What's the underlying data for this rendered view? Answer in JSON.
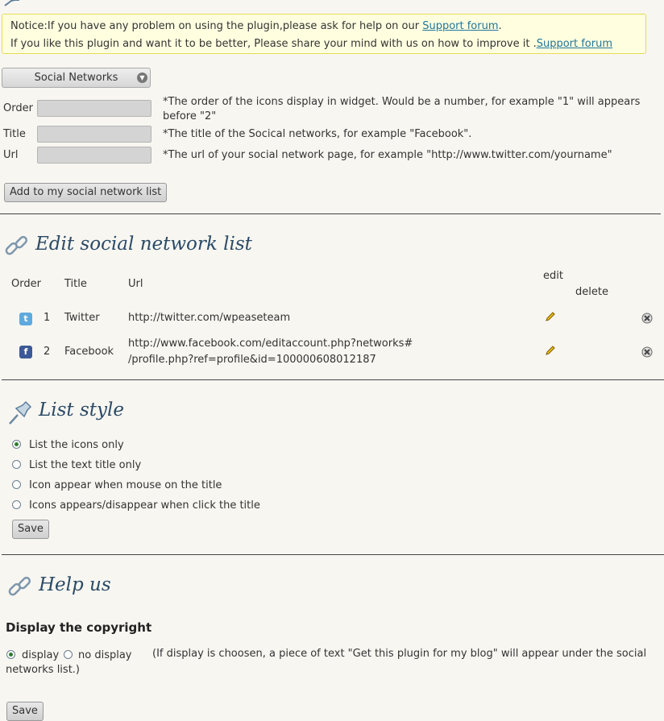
{
  "notice": {
    "line1_prefix": "Notice:If you have any problem on using the plugin,please ask for help on our ",
    "line1_link": "Support forum",
    "line1_suffix": ".",
    "line2_prefix": "If you like this plugin and want it to be better, Please share your mind with us on how to improve it .",
    "line2_link": "Support forum"
  },
  "add_form": {
    "network_select": "Social Networks",
    "fields": [
      {
        "label": "Order",
        "hint_line1": "*The order of the icons display in widget. Would be a number, for example \"1\" will appears",
        "hint_line2": "before \"2\""
      },
      {
        "label": "Title",
        "hint_line1": "*The title of the Socical networks, for example \"Facebook\"."
      },
      {
        "label": "Url",
        "hint_line1": "*The url of your social network page, for example \"http://www.twitter.com/yourname\""
      }
    ],
    "submit_label": "Add to my social network list"
  },
  "edit_list": {
    "heading": "Edit social network list",
    "columns": {
      "order": "Order",
      "title": "Title",
      "url": "Url",
      "edit": "edit",
      "delete": "delete"
    },
    "rows": [
      {
        "icon": "twitter-icon",
        "icon_color": "#5ea9dd",
        "order": "1",
        "title": "Twitter",
        "url_line1": "http://twitter.com/wpeaseteam",
        "url_line2": ""
      },
      {
        "icon": "facebook-icon",
        "icon_color": "#3b5998",
        "order": "2",
        "title": "Facebook",
        "url_line1": "http://www.facebook.com/editaccount.php?networks#",
        "url_line2": "/profile.php?ref=profile&id=100000608012187"
      }
    ]
  },
  "list_style": {
    "heading": "List style",
    "options": [
      {
        "label": "List the icons only",
        "selected": true
      },
      {
        "label": "List the text title only",
        "selected": false
      },
      {
        "label": "Icon appear when mouse on the title",
        "selected": false
      },
      {
        "label": "Icons appears/disappear when click the title",
        "selected": false
      }
    ],
    "save_label": "Save"
  },
  "help_us": {
    "heading": "Help us",
    "subheading": "Display the copyright",
    "option_display": "display",
    "option_no_display": "no display",
    "selected": "display",
    "note_line1": "(If display is choosen, a piece of text \"Get this plugin for my blog\" will appear under the social",
    "note_line2": "networks list.)",
    "save_label": "Save"
  },
  "colors": {
    "heading": "#2a4a66",
    "link": "#21759b",
    "notice_bg": "#ffffe0",
    "notice_border": "#e6db55"
  }
}
